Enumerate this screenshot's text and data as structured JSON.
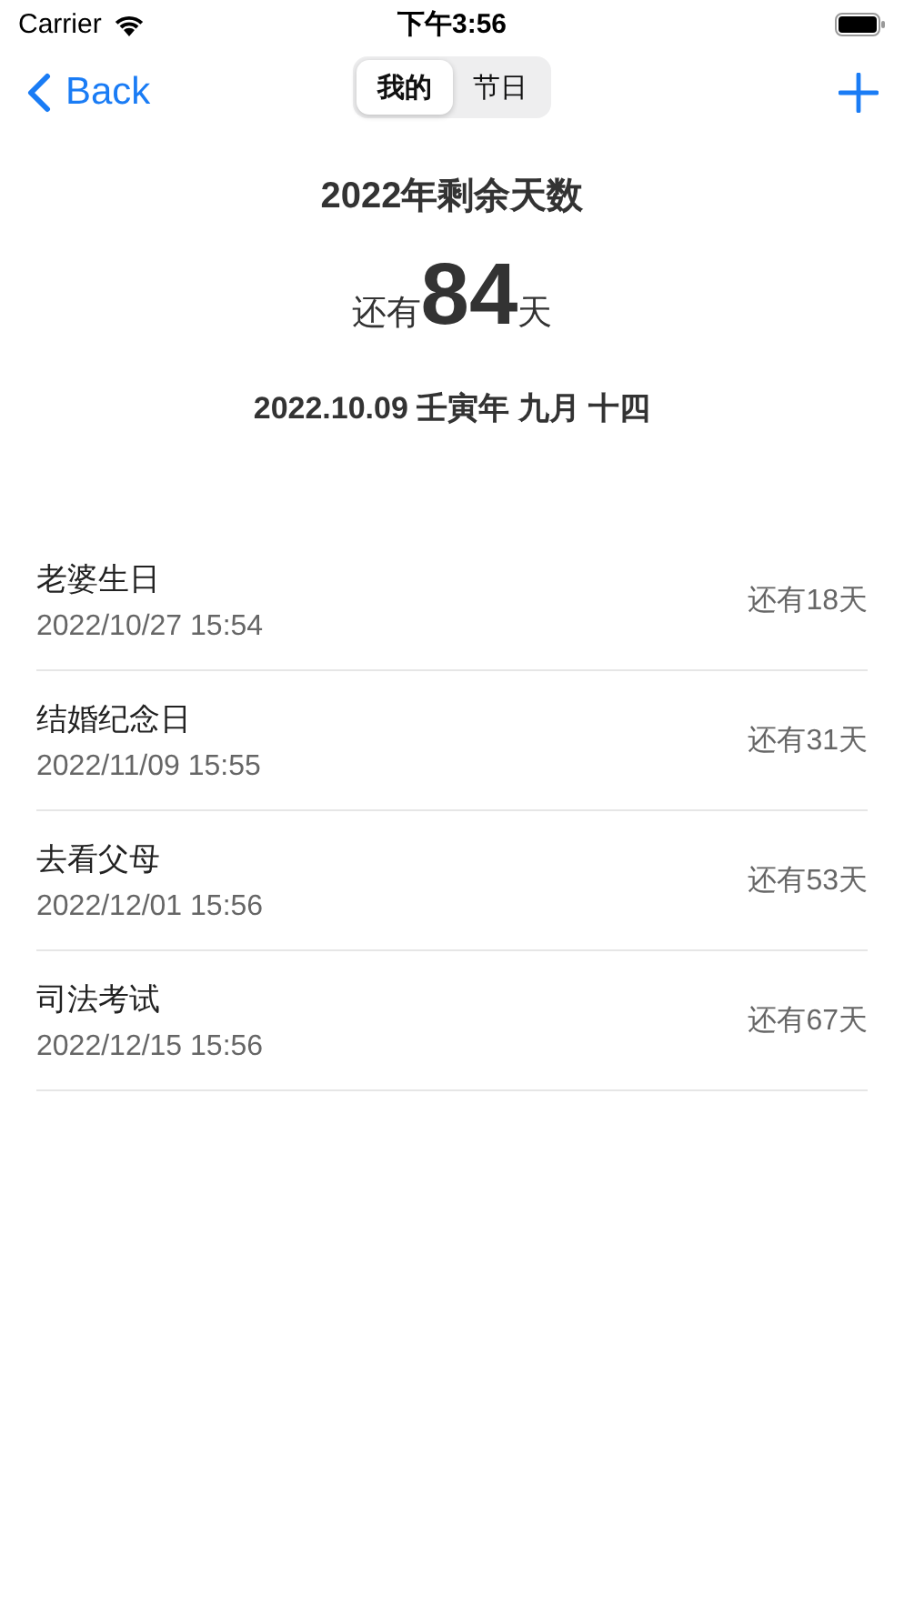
{
  "status_bar": {
    "carrier": "Carrier",
    "time": "下午3:56"
  },
  "nav": {
    "back": "Back",
    "segments": [
      {
        "label": "我的",
        "selected": true
      },
      {
        "label": "节日",
        "selected": false
      }
    ]
  },
  "summary": {
    "title": "2022年剩余天数",
    "prefix": "还有",
    "count": "84",
    "suffix": "天",
    "date": "2022.10.09 壬寅年 九月 十四"
  },
  "events": [
    {
      "name": "老婆生日",
      "datetime": "2022/10/27 15:54",
      "remaining": "还有18天"
    },
    {
      "name": "结婚纪念日",
      "datetime": "2022/11/09 15:55",
      "remaining": "还有31天"
    },
    {
      "name": "去看父母",
      "datetime": "2022/12/01 15:56",
      "remaining": "还有53天"
    },
    {
      "name": "司法考试",
      "datetime": "2022/12/15 15:56",
      "remaining": "还有67天"
    }
  ]
}
